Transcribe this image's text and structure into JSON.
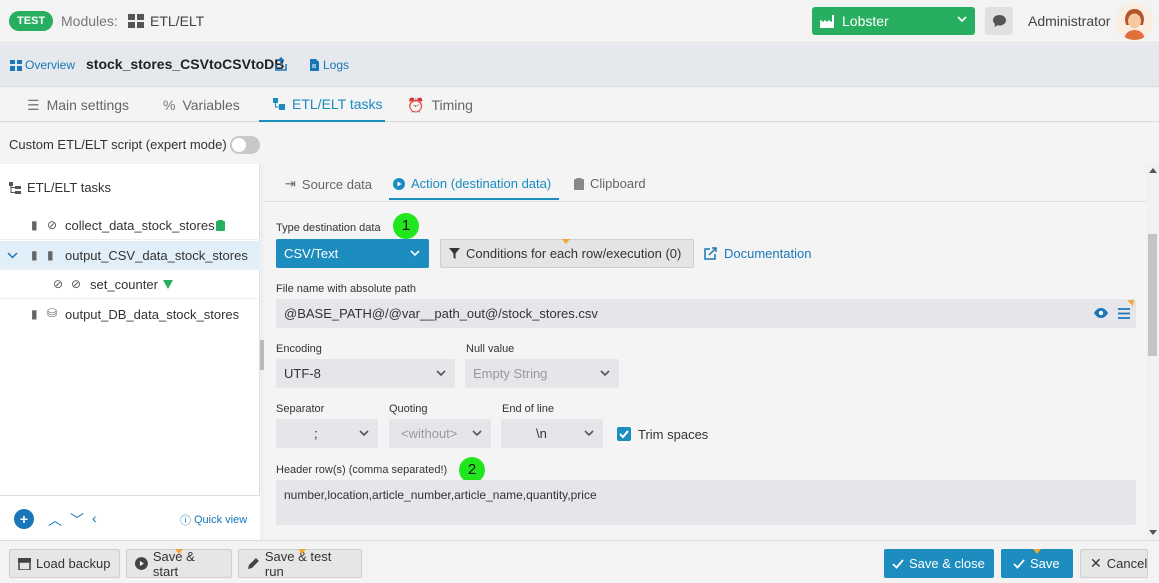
{
  "topbar": {
    "env_badge": "TEST",
    "modules_label": "Modules:",
    "module_name": "ETL/ELT",
    "project_select": "Lobster",
    "user_name": "Administrator",
    "icons": {
      "module": "modules-grid-icon",
      "project": "factory-icon",
      "chat": "chat-icon",
      "avatar": "user-avatar"
    }
  },
  "breadcrumb": {
    "overview": "Overview",
    "job_title": "stock_stores_CSVtoCSVtoDB",
    "logs": "Logs"
  },
  "main_tabs": [
    {
      "label": "Main settings",
      "icon": "list-icon",
      "active": false
    },
    {
      "label": "Variables",
      "icon": "percent-icon",
      "active": false
    },
    {
      "label": "ETL/ELT tasks",
      "icon": "tasks-icon",
      "active": true
    },
    {
      "label": "Timing",
      "icon": "clock-icon",
      "active": false
    }
  ],
  "custom_script": {
    "label": "Custom ETL/ELT script (expert mode)",
    "enabled": false
  },
  "tree": {
    "header": "ETL/ELT tasks",
    "items": [
      {
        "label": "collect_data_stock_stores",
        "selected": false,
        "expanded": false,
        "badge": "clipboard-icon"
      },
      {
        "label": "output_CSV_data_stock_stores",
        "selected": true,
        "expanded": true,
        "badge": ""
      },
      {
        "label": "set_counter",
        "selected": false,
        "child": true,
        "badge": "filter-icon"
      },
      {
        "label": "output_DB_data_stock_stores",
        "selected": false,
        "expanded": false,
        "badge": ""
      }
    ],
    "quick_view": "Quick view"
  },
  "sub_tabs": [
    {
      "label": "Source data",
      "icon": "import-icon",
      "active": false
    },
    {
      "label": "Action (destination data)",
      "icon": "play-icon",
      "active": true
    },
    {
      "label": "Clipboard",
      "icon": "clipboard-icon",
      "active": false
    }
  ],
  "form": {
    "type_label": "Type destination data",
    "type_value": "CSV/Text",
    "marker_1": "1",
    "conditions_btn": "Conditions for each row/execution (0)",
    "documentation": "Documentation",
    "path_label": "File name with absolute path",
    "path_value": "@BASE_PATH@/@var__path_out@/stock_stores.csv",
    "encoding_label": "Encoding",
    "encoding_value": "UTF-8",
    "null_label": "Null value",
    "null_value": "Empty String",
    "separator_label": "Separator",
    "separator_value": ";",
    "quoting_label": "Quoting",
    "quoting_value": "<without>",
    "eol_label": "End of line",
    "eol_value": "\\n",
    "trim_label": "Trim spaces",
    "trim_checked": true,
    "header_label": "Header row(s) (comma separated!)",
    "marker_2": "2",
    "header_value": "number,location,article_number,article_name,quantity,price"
  },
  "bottom": {
    "load_backup": "Load backup",
    "save_start": "Save & start",
    "save_test": "Save & test run",
    "save_close": "Save & close",
    "save": "Save",
    "cancel": "Cancel"
  },
  "colors": {
    "accent": "#1c8dbe",
    "green": "#27ae60",
    "marker": "#22e61d",
    "link": "#1976b8"
  }
}
